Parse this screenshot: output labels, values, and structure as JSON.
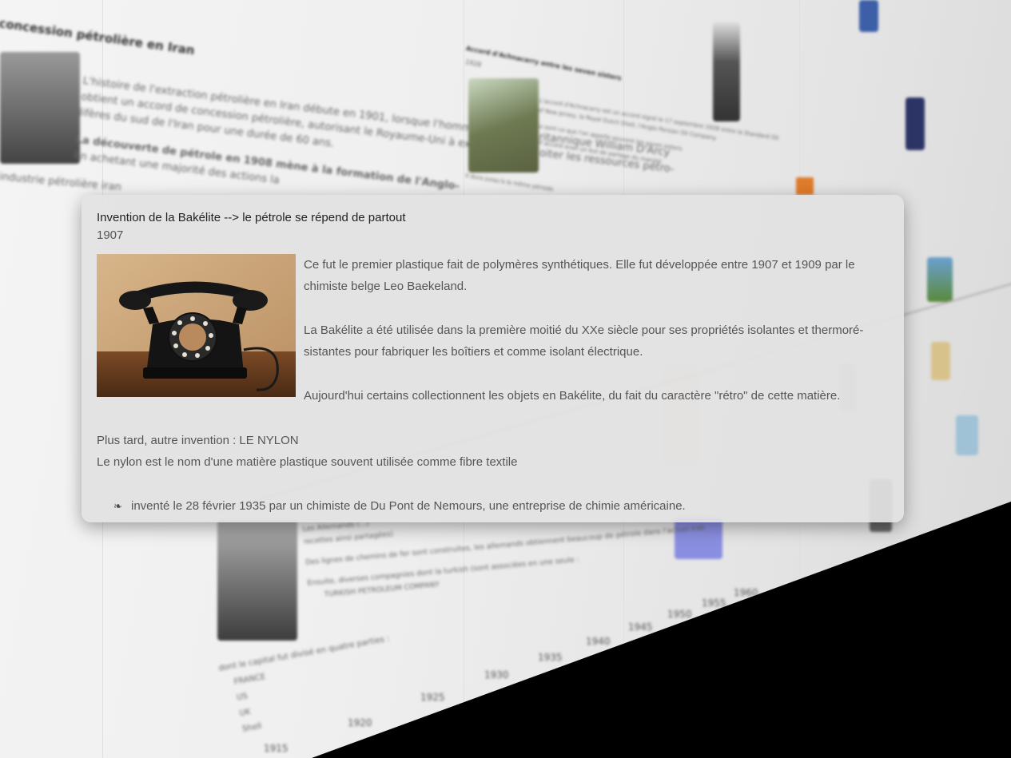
{
  "popup": {
    "title": "Invention de la Bakélite --> le pétrole se répend de partout",
    "year": "1907",
    "paragraphs": [
      "Ce fut le premier plastique fait de polymères synthétiques. Elle fut développée entre 1907 et 1909 par le chimiste belge Leo Baekeland.",
      "La Bakélite a été utilisée dans la première moitié du XXe siècle pour ses propriétés isolantes et thermoré-sistantes pour fabriquer les boîtiers et comme isolant électrique.",
      "Aujourd'hui certains collectionnent les objets en Bakélite, du fait du caractère \"rétro\" de cette matière."
    ],
    "later": "Plus tard, autre invention : LE NYLON",
    "nylon_text": "Le nylon est le nom d'une matière plastique souvent utilisée comme fibre textile",
    "bullet_icon": "fleuron-bullet",
    "bullet_symbol": "❧",
    "bullet_text": "inventé le 28 février 1935 par un chimiste de Du Pont de Nemours,   une entreprise de chimie américaine.",
    "image_alt": "black-bakelite-rotary-telephone"
  },
  "background": {
    "event1_title": "concession pétrolière en Iran",
    "event1_lines": [
      "L'histoire de l'extraction pétrolière en Iran débute en 1901, lorsque l'homme d'affaires britannique William D'Arcy",
      "obtient un accord de concession pétrolière, autorisant le Royaume-Uni à explorer et exploiter les ressources pétro-",
      "lifères du sud de l'Iran pour une durée de 60 ans.",
      "La découverte de pétrole en 1908 mène à la formation de l'Anglo-",
      "En achetant une majorité des actions la",
      "industrie pétrolière iran"
    ],
    "event2_title": "Accord d'Achnacarry entre les seven sisters",
    "event2_year": "1928",
    "event2_lines": [
      "L'accord d'Achnacarry est un accord signé le 17 septembre 1928 entre la Standard Oil",
      "of New Jersey, la Royal Dutch Shell, l'Anglo Persian Oil Company.",
      "Ce sont ce que l'on appelle souvent les seven sisters",
      "Cet accord avait un but de partage du marché",
      "Il dura jusqu'à la même période"
    ],
    "event3_lines": [
      "Les Allemands (...)",
      "recettes ainsi partagées)",
      "Des lignes de chemins de fer sont construites, les allemands obtiennent beaucoup de pétrole dans l'actuel Irak",
      "Ensuite, diverses compagnies dont la turkish (sont associées en une seule :",
      "TURKISH PETROLEUM COMPANY",
      "dont le capital fut divisé en quatre parties :",
      "FRANCE",
      "US",
      "UK",
      "Shell"
    ],
    "axis_years": [
      "1915",
      "1920",
      "1925",
      "1930",
      "1935",
      "1940",
      "1945",
      "1950",
      "1955",
      "1960"
    ]
  }
}
